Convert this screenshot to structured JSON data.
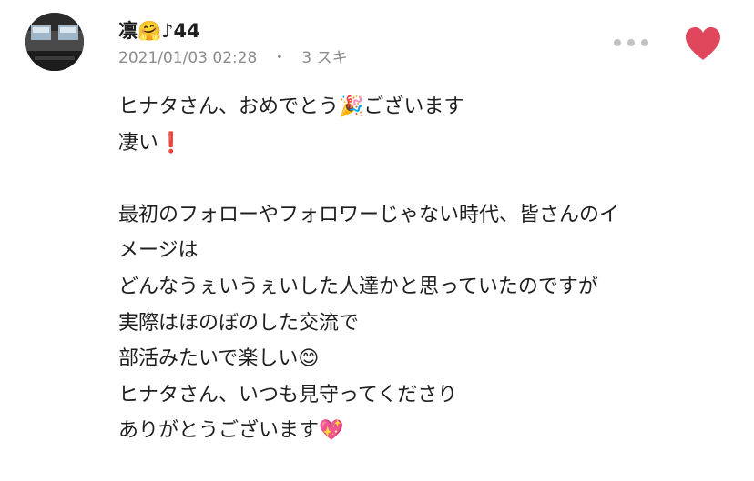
{
  "comment": {
    "avatar_icon": "avatar-photo-icon",
    "username": "凛🤗♪44",
    "timestamp": "2021/01/03 02:28",
    "separator": "・",
    "likes": "3 スキ",
    "more_icon": "more-dots-icon",
    "heart_icon": "heart-icon",
    "heart_color": "#e0475d",
    "lines": [
      "ヒナタさん、おめでとう🎉ございます",
      "凄い❗️",
      "",
      "最初のフォローやフォロワーじゃない時代、皆さんのイ",
      "メージは",
      "どんなうぇいうぇいした人達かと思っていたのですが",
      "実際はほのぼのした交流で",
      "部活みたいで楽しい😊",
      "ヒナタさん、いつも見守ってくださり",
      "ありがとうございます💖"
    ]
  }
}
